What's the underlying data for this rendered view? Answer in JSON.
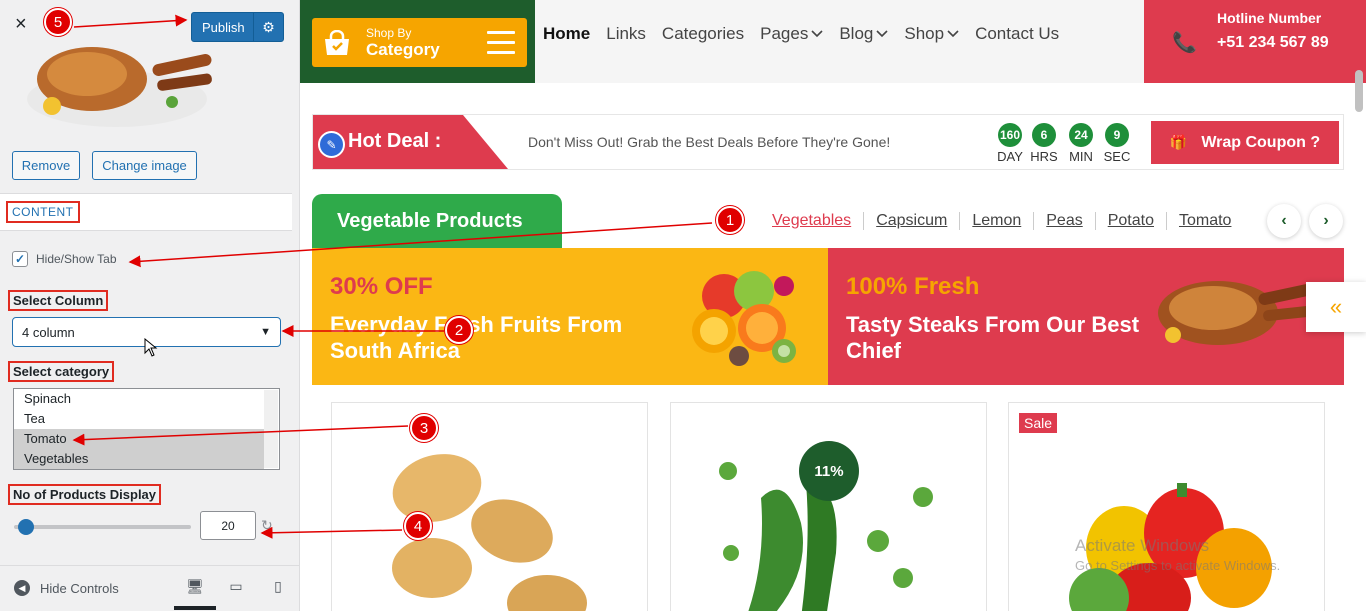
{
  "panel": {
    "close_glyph": "×",
    "publish_label": "Publish",
    "remove_label": "Remove",
    "change_image_label": "Change image",
    "section_title": "CONTENT",
    "hide_show_label": "Hide/Show Tab",
    "select_column_label": "Select Column",
    "select_column_value": "4 column",
    "select_category_label": "Select category",
    "category_options": [
      {
        "label": "Spinach",
        "selected": false
      },
      {
        "label": "Tea",
        "selected": false
      },
      {
        "label": "Tomato",
        "selected": true
      },
      {
        "label": "Vegetables",
        "selected": true
      }
    ],
    "products_label": "No of Products Display",
    "products_value": "20",
    "hide_controls_label": "Hide Controls",
    "accent_color": "#2271b1"
  },
  "header": {
    "shop_by": "Shop By",
    "category": "Category",
    "nav": [
      "Home",
      "Links",
      "Categories",
      "Pages",
      "Blog",
      "Shop",
      "Contact Us"
    ],
    "nav_dropdowns": [
      false,
      false,
      false,
      true,
      true,
      true,
      false
    ],
    "hotline_title": "Hotline Number",
    "hotline_number": "+51 234 567 89"
  },
  "hot_deal": {
    "label": "Hot Deal :",
    "text": "Don't Miss Out! Grab the Best Deals Before They're Gone!",
    "countdown": [
      {
        "value": "160",
        "unit": "DAY"
      },
      {
        "value": "6",
        "unit": "HRS"
      },
      {
        "value": "24",
        "unit": "MIN"
      },
      {
        "value": "9",
        "unit": "SEC"
      }
    ],
    "coupon_label": "Wrap Coupon ?"
  },
  "products": {
    "section_title": "Vegetable Products",
    "tabs": [
      "Vegetables",
      "Capsicum",
      "Lemon",
      "Peas",
      "Potato",
      "Tomato"
    ],
    "active_tab": "Vegetables"
  },
  "banners": [
    {
      "offer": "30% OFF",
      "title": "Everyday Fresh Fruits From South Africa"
    },
    {
      "offer": "100% Fresh",
      "title": "Tasty Steaks From Our Best Chief"
    }
  ],
  "cards": {
    "sale_label": "Sale",
    "discount_label": "11%"
  },
  "watermark": {
    "line1": "Activate Windows",
    "line2": "Go to Settings to activate Windows."
  },
  "annotations": [
    "1",
    "2",
    "3",
    "4",
    "5"
  ],
  "colors": {
    "brand_red": "#de3b4e",
    "brand_green": "#1e5d2c",
    "brand_orange": "#f6a500",
    "annotation_red": "#e00000"
  }
}
